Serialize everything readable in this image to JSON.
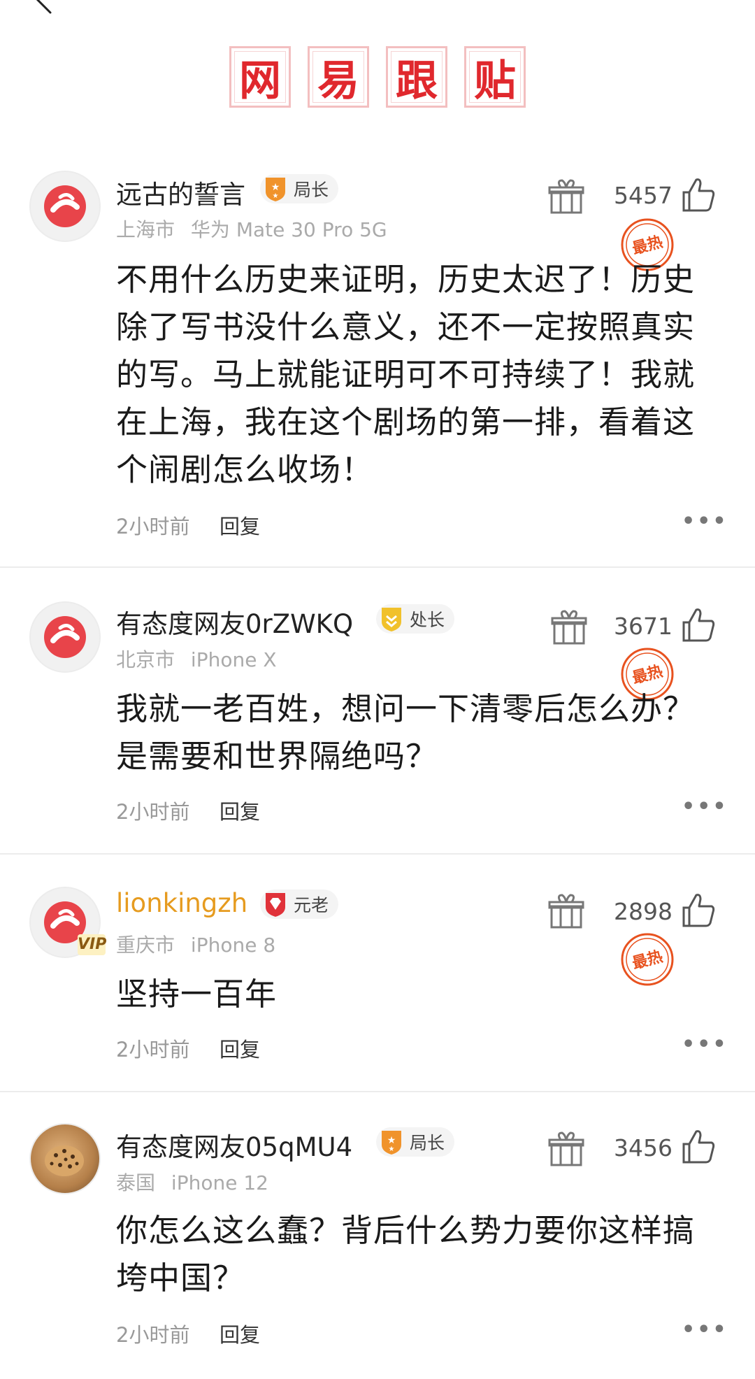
{
  "brand": [
    "网",
    "易",
    "跟",
    "贴"
  ],
  "labels": {
    "reply": "回复",
    "more": "•••",
    "hot": "最热"
  },
  "comments": [
    {
      "username": "远古的誓言",
      "badge": "局长",
      "location": "上海市",
      "device": "华为 Mate 30 Pro 5G",
      "likes": "5457",
      "hot": true,
      "text": "不用什么历史来证明，历史太迟了！历史除了写书没什么意义，还不一定按照真实的写。马上就能证明可不可持续了！我就在上海，我在这个剧场的第一排，看着这个闹剧怎么收场！",
      "time": "2小时前"
    },
    {
      "username": "有态度网友0rZWKQ",
      "badge": "处长",
      "location": "北京市",
      "device": "iPhone X",
      "likes": "3671",
      "hot": true,
      "text": "我就一老百姓，想问一下清零后怎么办？是需要和世界隔绝吗？",
      "time": "2小时前"
    },
    {
      "username": "lionkingzh",
      "badge": "元老",
      "vip": "VIP",
      "location": "重庆市",
      "device": "iPhone 8",
      "likes": "2898",
      "hot": true,
      "text": "坚持一百年",
      "time": "2小时前"
    },
    {
      "username": "有态度网友05qMU4",
      "badge": "局长",
      "location": "泰国",
      "device": "iPhone 12",
      "likes": "3456",
      "hot": false,
      "text": "你怎么这么蠢？背后什么势力要你这样搞垮中国？",
      "time": "2小时前"
    }
  ],
  "colors": {
    "brand_red": "#e0282d",
    "vip_gold": "#e69b1f",
    "hot_orange": "#e8521f"
  }
}
